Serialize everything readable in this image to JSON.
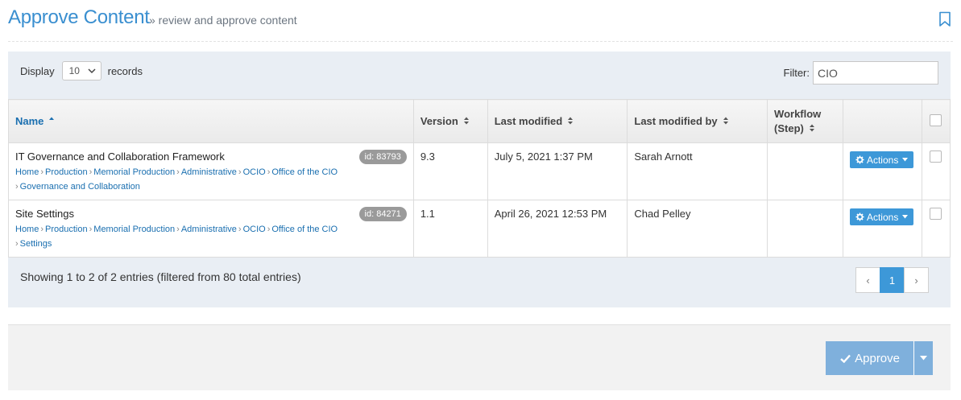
{
  "header": {
    "title": "Approve Content",
    "subtitle": "» review and approve content",
    "bookmark_icon": "bookmark-icon"
  },
  "toolbar": {
    "display_label": "Display",
    "display_value": "10",
    "records_label": "records",
    "filter_label": "Filter:",
    "filter_value": "CIO"
  },
  "table": {
    "columns": {
      "name": "Name",
      "version": "Version",
      "last_modified": "Last modified",
      "last_modified_by": "Last modified by",
      "workflow": "Workflow",
      "workflow_step": "(Step)"
    },
    "rows": [
      {
        "title": "IT Governance and Collaboration Framework",
        "id": "id: 83793",
        "crumbs": [
          "Home",
          "Production",
          "Memorial Production",
          "Administrative",
          "OCIO",
          "Office of the CIO",
          "Governance and Collaboration"
        ],
        "version": "9.3",
        "last_modified": "July 5, 2021 1:37 PM",
        "last_modified_by": "Sarah Arnott",
        "workflow": "",
        "actions_label": "Actions"
      },
      {
        "title": "Site Settings",
        "id": "id: 84271",
        "crumbs": [
          "Home",
          "Production",
          "Memorial Production",
          "Administrative",
          "OCIO",
          "Office of the CIO",
          "Settings"
        ],
        "version": "1.1",
        "last_modified": "April 26, 2021 12:53 PM",
        "last_modified_by": "Chad Pelley",
        "workflow": "",
        "actions_label": "Actions"
      }
    ]
  },
  "footer": {
    "info": "Showing 1 to 2 of 2 entries (filtered from 80 total entries)",
    "pager": {
      "prev": "‹",
      "current": "1",
      "next": "›"
    }
  },
  "bottom": {
    "approve_label": "Approve"
  },
  "colors": {
    "accent": "#3d98d8",
    "title": "#3a8fd0",
    "approve": "#7fb0dc"
  }
}
